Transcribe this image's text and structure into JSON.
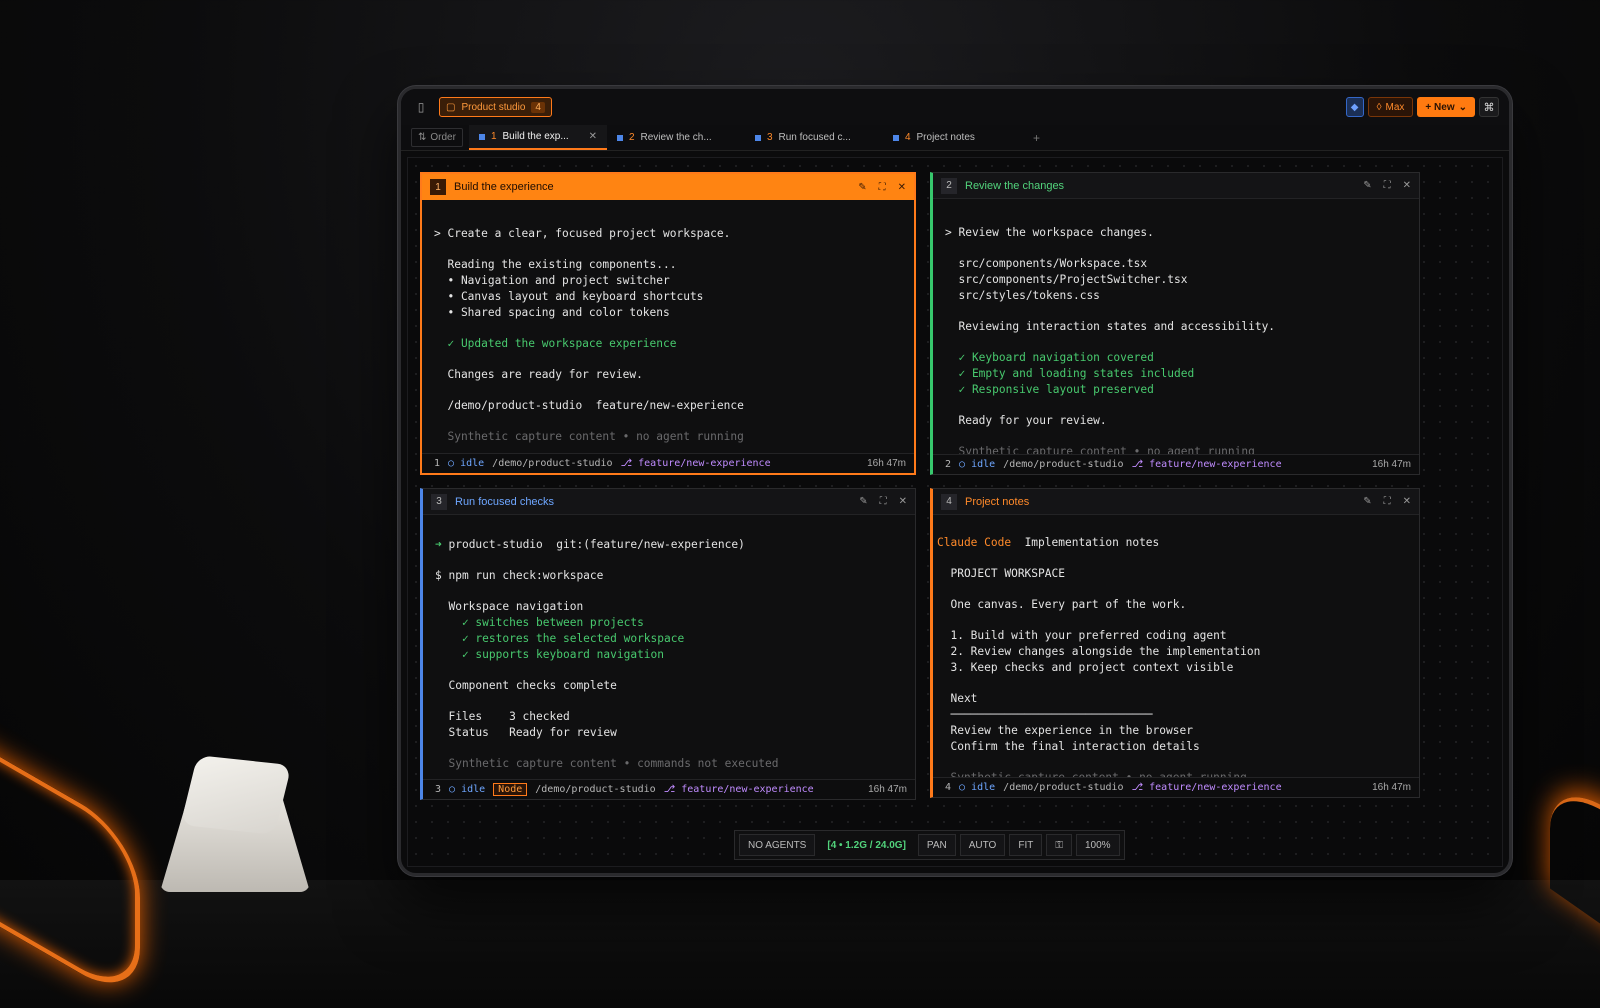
{
  "topbar": {
    "project_name": "Product studio",
    "project_count": "4",
    "max_label": "Max",
    "new_label": "+ New",
    "cmd_glyph": "⌘"
  },
  "tabs": {
    "order_label": "Order",
    "items": [
      {
        "num": "1",
        "label": "Build the exp..."
      },
      {
        "num": "2",
        "label": "Review the ch..."
      },
      {
        "num": "3",
        "label": "Run focused c..."
      },
      {
        "num": "4",
        "label": "Project notes"
      }
    ],
    "add_glyph": "+"
  },
  "panes": {
    "p1": {
      "num": "1",
      "title": "Build the experience",
      "lines": {
        "l1": "> Create a clear, focused project workspace.",
        "l2": "  Reading the existing components...",
        "l3": "  • Navigation and project switcher",
        "l4": "  • Canvas layout and keyboard shortcuts",
        "l5": "  • Shared spacing and color tokens",
        "l6": "  ✓ Updated the workspace experience",
        "l7": "  Changes are ready for review.",
        "l8": "  /demo/product-studio  feature/new-experience",
        "l9": "  Synthetic capture content • no agent running"
      },
      "footer": {
        "num": "1",
        "status": "idle",
        "path": "/demo/product-studio",
        "branch": "feature/new-experience",
        "time": "16h 47m"
      }
    },
    "p2": {
      "num": "2",
      "title": "Review the changes",
      "lines": {
        "l1": "> Review the workspace changes.",
        "l2": "  src/components/Workspace.tsx",
        "l3": "  src/components/ProjectSwitcher.tsx",
        "l4": "  src/styles/tokens.css",
        "l5": "  Reviewing interaction states and accessibility.",
        "l6": "  ✓ Keyboard navigation covered",
        "l7": "  ✓ Empty and loading states included",
        "l8": "  ✓ Responsive layout preserved",
        "l9": "  Ready for your review.",
        "l10": "  Synthetic capture content • no agent running"
      },
      "footer": {
        "num": "2",
        "status": "idle",
        "path": "/demo/product-studio",
        "branch": "feature/new-experience",
        "time": "16h 47m"
      }
    },
    "p3": {
      "num": "3",
      "title": "Run focused checks",
      "lines": {
        "l1a": "➜ ",
        "l1b": "product-studio  git:(feature/new-experience)",
        "l2": "$ npm run check:workspace",
        "l3": "  Workspace navigation",
        "l4": "    ✓ switches between projects",
        "l5": "    ✓ restores the selected workspace",
        "l6": "    ✓ supports keyboard navigation",
        "l7": "  Component checks complete",
        "l8": "  Files    3 checked",
        "l9": "  Status   Ready for review",
        "l10": "  Synthetic capture content • commands not executed"
      },
      "footer": {
        "num": "3",
        "status": "idle",
        "tag": "Node",
        "path": "/demo/product-studio",
        "branch": "feature/new-experience",
        "time": "16h 47m"
      }
    },
    "p4": {
      "num": "4",
      "title": "Project notes",
      "lines": {
        "h1": "Claude Code",
        "h2": "  Implementation notes",
        "l1": "  PROJECT WORKSPACE",
        "l2": "  One canvas. Every part of the work.",
        "l3": "  1. Build with your preferred coding agent",
        "l4": "  2. Review changes alongside the implementation",
        "l5": "  3. Keep checks and project context visible",
        "l6": "  Next",
        "l7": "  ──────────────────────────────",
        "l8": "  Review the experience in the browser",
        "l9": "  Confirm the final interaction details",
        "l10": "  Synthetic capture content • no agent running"
      },
      "footer": {
        "num": "4",
        "status": "idle",
        "path": "/demo/product-studio",
        "branch": "feature/new-experience",
        "time": "16h 47m"
      }
    }
  },
  "statusbar": {
    "agents": "NO AGENTS",
    "resources": "[4 • 1.2G / 24.0G]",
    "pan": "PAN",
    "auto": "AUTO",
    "fit": "FIT",
    "zoom": "100%"
  }
}
